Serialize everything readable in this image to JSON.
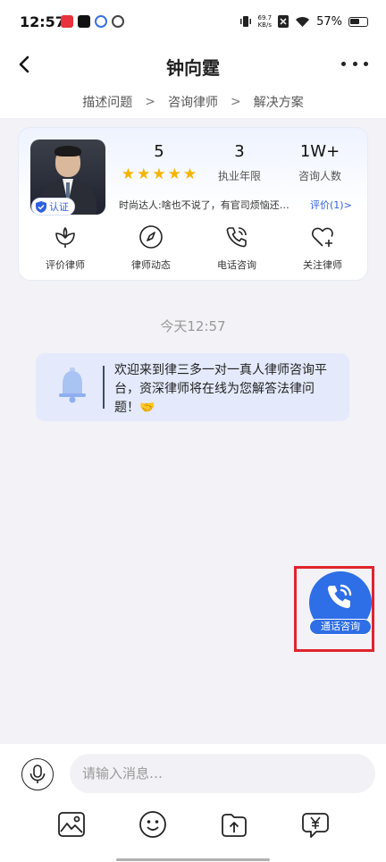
{
  "status": {
    "time": "12:57",
    "speed_value": "69.7",
    "speed_unit": "KB/s",
    "battery": "57%"
  },
  "header": {
    "title": "钟向霆",
    "back_icon": "back-arrow-icon",
    "more_icon": "more-dots-icon"
  },
  "steps": [
    "描述问题",
    "咨询律师",
    "解决方案"
  ],
  "lawyer": {
    "certified_label": "认证",
    "rating_value": "5",
    "rating_stars": 5,
    "years_value": "3",
    "years_label": "执业年限",
    "consults_value": "1W+",
    "consults_label": "咨询人数",
    "bio": "时尚达人:啥也不说了，有官司烦恼还…",
    "review_link": "评价(1)>"
  },
  "actions": [
    {
      "label": "评价律师",
      "icon": "rate-flower-icon"
    },
    {
      "label": "律师动态",
      "icon": "compass-icon"
    },
    {
      "label": "电话咨询",
      "icon": "phone-icon"
    },
    {
      "label": "关注律师",
      "icon": "heart-plus-icon"
    }
  ],
  "chat": {
    "time_divider": "今天12:57",
    "notice_text": "欢迎来到律三多一对一真人律师咨询平台，资深律师将在线为您解答法律问题！🤝"
  },
  "floating_call": {
    "label": "通话咨询",
    "icon": "phone-call-icon",
    "color": "#2e6ee6",
    "highlight_color": "#e0242d"
  },
  "composer": {
    "placeholder": "请输入消息…",
    "value": ""
  },
  "toolbar": [
    "image-icon",
    "emoji-icon",
    "upload-file-icon",
    "payment-yuan-icon"
  ]
}
